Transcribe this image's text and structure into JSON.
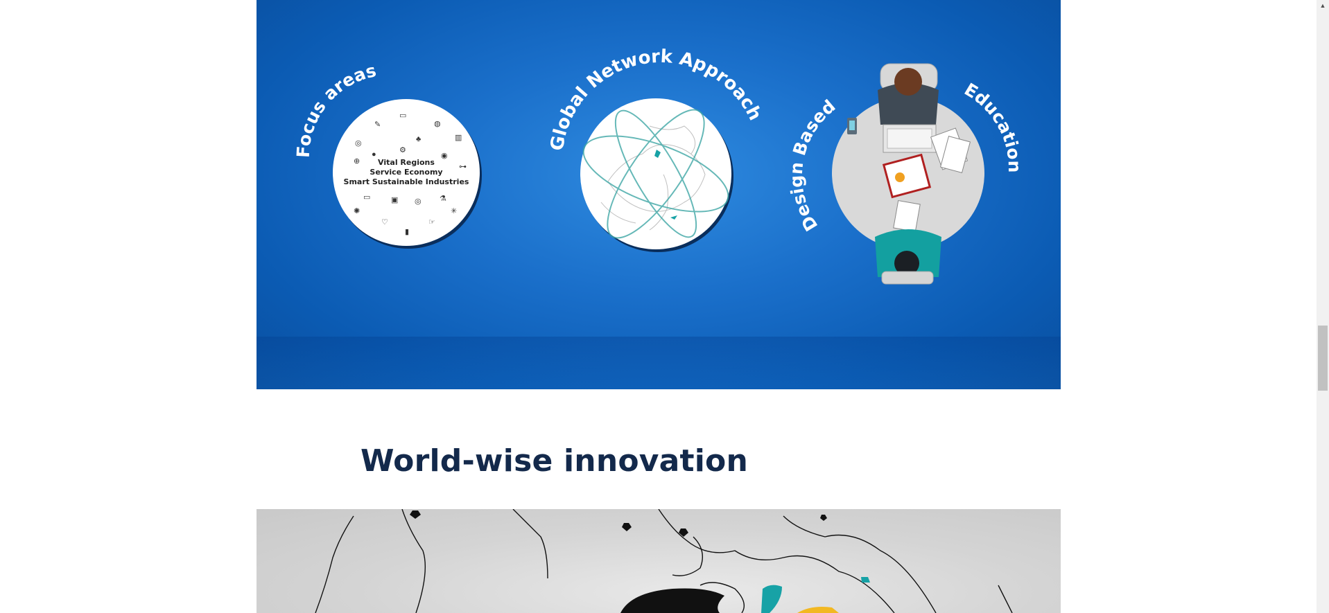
{
  "hero": {
    "focus": {
      "arc_label": "Focus areas",
      "lines": [
        "Vital Regions",
        "Service Economy",
        "Smart Sustainable Industries"
      ]
    },
    "global": {
      "arc_label": "Global Network Approach"
    },
    "design": {
      "arc_label_left": "Design Based",
      "arc_label_right": "Education"
    },
    "next_icon": "chevron-right-icon"
  },
  "section": {
    "heading": "World-wise innovation"
  },
  "colors": {
    "hero_blue": "#1a6fca",
    "heading": "#13294b",
    "teal": "#17a2a6"
  }
}
